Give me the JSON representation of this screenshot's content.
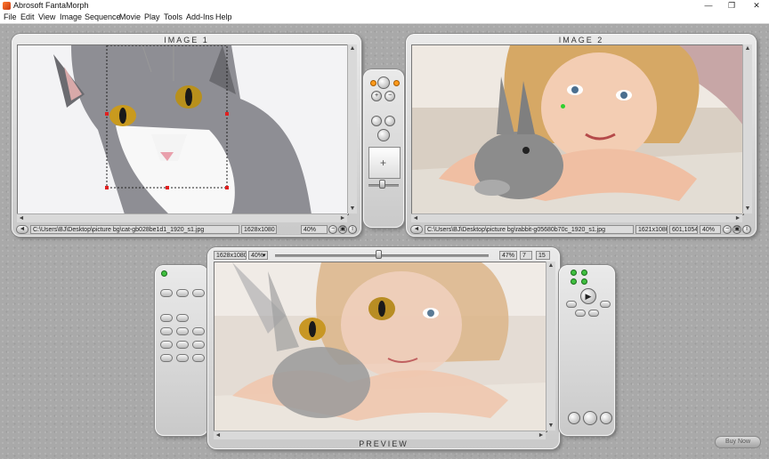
{
  "window": {
    "title": "Abrosoft FantaMorph",
    "minimize_glyph": "—",
    "maximize_glyph": "❐",
    "close_glyph": "✕"
  },
  "menu": [
    "File",
    "Edit",
    "View",
    "Image",
    "Sequence",
    "Movie",
    "Play",
    "Tools",
    "Add-Ins",
    "Help"
  ],
  "image1": {
    "title": "IMAGE 1",
    "path": "C:\\Users\\BJ\\Desktop\\picture bg\\cat-gb028be1d1_1920_s1.jpg",
    "size": "1628x1080",
    "zoom": "40%"
  },
  "image2": {
    "title": "IMAGE 2",
    "path": "C:\\Users\\BJ\\Desktop\\picture bg\\rabbit-g05680b70c_1920_s1.jpg",
    "size": "1621x1080",
    "coords": "601,1054",
    "zoom": "40%"
  },
  "preview": {
    "title": "PREVIEW",
    "size": "1628x1080",
    "zoom": "40%",
    "percent": "47%",
    "frame": "7",
    "frames": "15"
  },
  "buy_now": "Buy Now",
  "icons": {
    "nav_button": "◄",
    "zoom_in": "+",
    "zoom_out": "−",
    "fit": "▣",
    "info": "i",
    "play": "▶",
    "dropdown": "▾"
  },
  "colors": {
    "accent_led": "#3fbf3f",
    "marker": "#e02020",
    "panel": "#d6d6d6"
  }
}
